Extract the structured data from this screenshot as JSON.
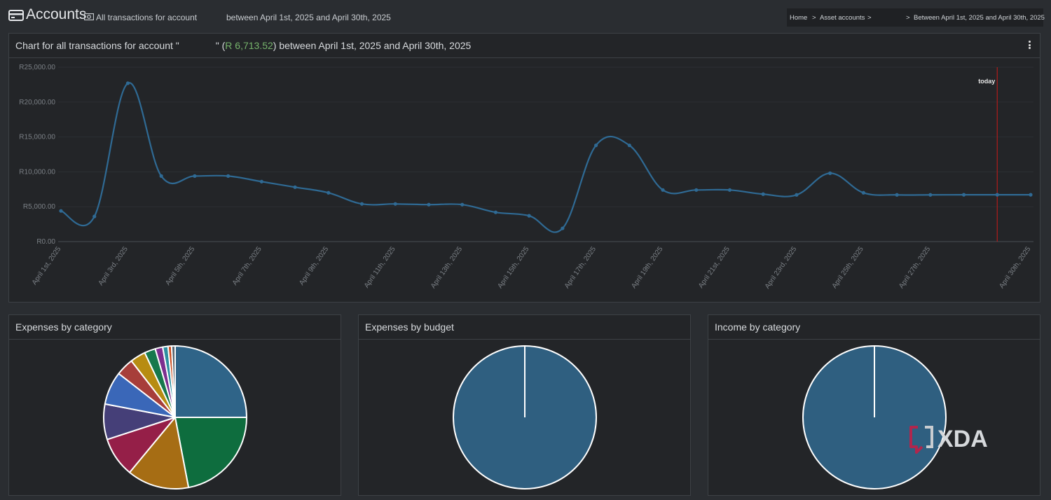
{
  "header": {
    "title": "Accounts",
    "subtitle_left": "All transactions for account",
    "subtitle_right": "between April 1st, 2025 and April 30th, 2025"
  },
  "breadcrumb": {
    "home": "Home",
    "asset_accounts": "Asset accounts",
    "current": "Between April 1st, 2025 and April 30th, 2025",
    "separator": ">"
  },
  "main_panel": {
    "title_prefix": "Chart for all transactions for account \"",
    "title_mid": "\" (",
    "balance": "R 6,713.52",
    "title_suffix": ") between April 1st, 2025 and April 30th, 2025"
  },
  "chart_data": {
    "type": "line",
    "title": "",
    "xlabel": "",
    "ylabel": "",
    "ylim": [
      0,
      25000
    ],
    "yticks": [
      "R0.00",
      "R5,000.00",
      "R10,000.00",
      "R15,000.00",
      "R20,000.00",
      "R25,000.00"
    ],
    "x_labels": [
      "April 1st, 2025",
      "April 3rd, 2025",
      "April 5th, 2025",
      "April 7th, 2025",
      "April 9th, 2025",
      "April 11th, 2025",
      "April 13th, 2025",
      "April 15th, 2025",
      "April 17th, 2025",
      "April 19th, 2025",
      "April 21st, 2025",
      "April 23rd, 2025",
      "April 25th, 2025",
      "April 27th, 2025",
      "April 30th, 2025"
    ],
    "x_label_days": [
      1,
      3,
      5,
      7,
      9,
      11,
      13,
      15,
      17,
      19,
      21,
      23,
      25,
      27,
      30
    ],
    "series": [
      {
        "color": "#2f6a94",
        "days": [
          1,
          2,
          3,
          4,
          5,
          6,
          7,
          8,
          9,
          10,
          11,
          12,
          13,
          14,
          15,
          16,
          17,
          18,
          19,
          20,
          21,
          22,
          23,
          24,
          25,
          26,
          27,
          28,
          29,
          30
        ],
        "values": [
          4400,
          3600,
          22700,
          9400,
          9400,
          9400,
          8600,
          7800,
          7000,
          5400,
          5400,
          5300,
          5300,
          4200,
          3700,
          1900,
          13800,
          13800,
          7400,
          7400,
          7400,
          6800,
          6700,
          9800,
          7000,
          6700,
          6700,
          6713,
          6713,
          6713
        ]
      }
    ],
    "today_marker": {
      "day": 29,
      "label": "today",
      "color": "#b01b1b"
    },
    "grid": true
  },
  "pie_panels": [
    {
      "title": "Expenses by category",
      "slices": [
        {
          "value": 25,
          "color": "#2f6488"
        },
        {
          "value": 22,
          "color": "#0e6d3e"
        },
        {
          "value": 14,
          "color": "#a66d14"
        },
        {
          "value": 9,
          "color": "#951f48"
        },
        {
          "value": 8,
          "color": "#453f78"
        },
        {
          "value": 7.5,
          "color": "#3a67b8"
        },
        {
          "value": 4,
          "color": "#a73e3a"
        },
        {
          "value": 3.5,
          "color": "#b78c12"
        },
        {
          "value": 2.5,
          "color": "#17784c"
        },
        {
          "value": 1.7,
          "color": "#7c2f8f"
        },
        {
          "value": 1.2,
          "color": "#2e8fa0"
        },
        {
          "value": 0.8,
          "color": "#c94a1c"
        },
        {
          "value": 0.8,
          "color": "#556470"
        }
      ]
    },
    {
      "title": "Expenses by budget",
      "slices": [
        {
          "value": 100,
          "color": "#2f5f80"
        }
      ]
    },
    {
      "title": "Income by category",
      "slices": [
        {
          "value": 100,
          "color": "#2f5f80"
        }
      ]
    }
  ],
  "watermark": {
    "text": "XDA"
  }
}
